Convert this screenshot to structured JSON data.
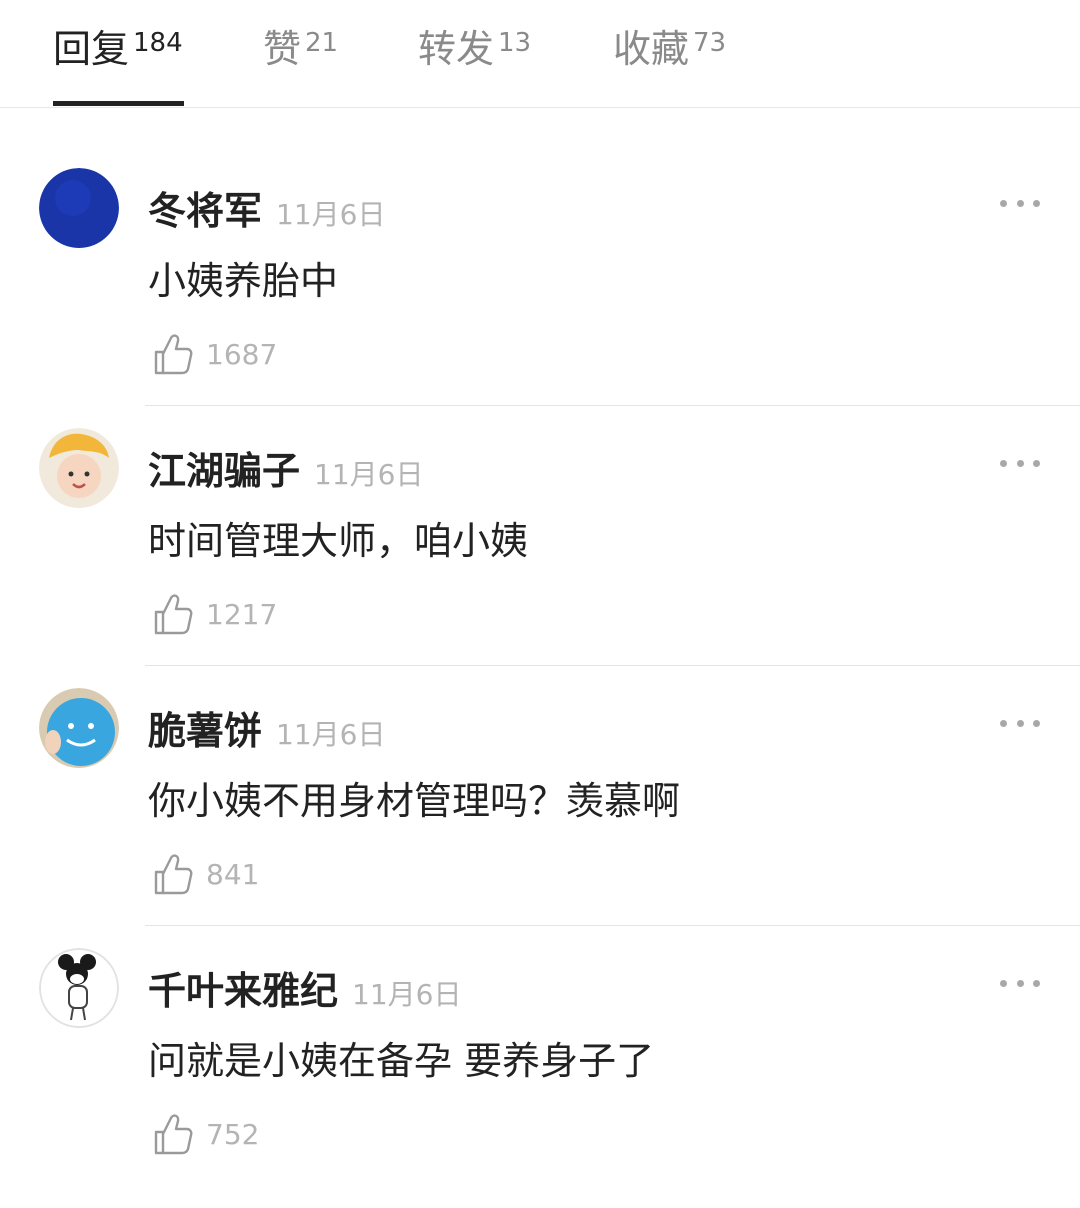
{
  "tabs": [
    {
      "label": "回复",
      "count": "184"
    },
    {
      "label": "赞",
      "count": "21"
    },
    {
      "label": "转发",
      "count": "13"
    },
    {
      "label": "收藏",
      "count": "73"
    }
  ],
  "comments": [
    {
      "username": "冬将军",
      "date": "11月6日",
      "text": "小姨养胎中",
      "likes": "1687",
      "avatar_icon": "blue-avatar-icon"
    },
    {
      "username": "江湖骗子",
      "date": "11月6日",
      "text": "时间管理大师，咱小姨",
      "likes": "1217",
      "avatar_icon": "child-avatar-icon"
    },
    {
      "username": "脆薯饼",
      "date": "11月6日",
      "text": "你小姨不用身材管理吗？羡慕啊",
      "likes": "841",
      "avatar_icon": "smiley-avatar-icon"
    },
    {
      "username": "千叶来雅纪",
      "date": "11月6日",
      "text": "问就是小姨在备孕 要养身子了",
      "likes": "752",
      "avatar_icon": "mouse-avatar-icon"
    }
  ],
  "icons": {
    "more": "more-dots-icon",
    "like": "thumbs-up-icon"
  },
  "colors": {
    "primary_text": "#222222",
    "secondary_text": "#8a8a8a",
    "muted_text": "#b4b4b4",
    "divider": "#e4e4e4"
  }
}
